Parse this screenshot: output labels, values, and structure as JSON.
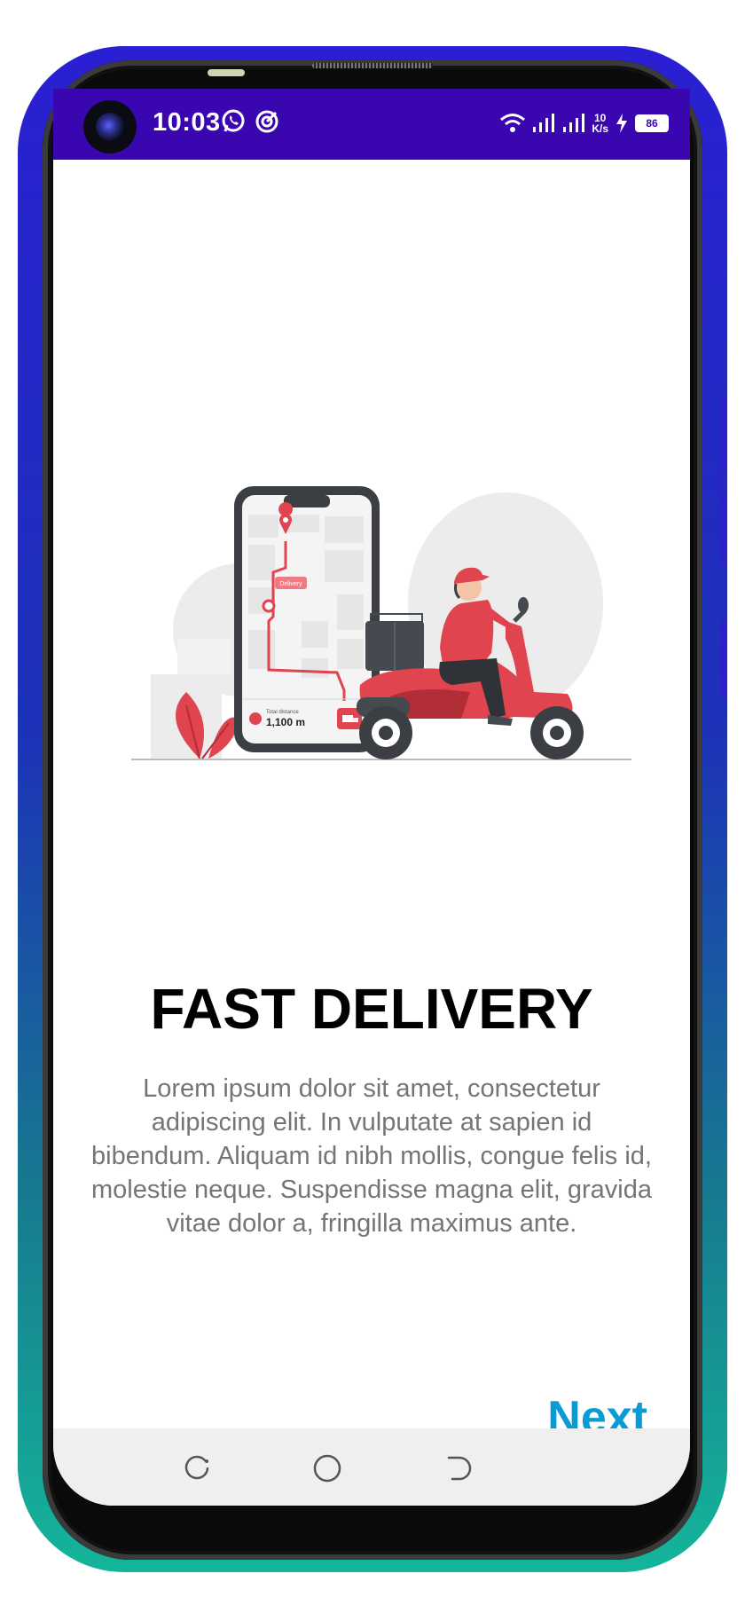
{
  "status_bar": {
    "time": "10:03",
    "network_speed_top": "10",
    "network_speed_unit": "K/s",
    "battery_level": "86",
    "icons": [
      "whatsapp-icon",
      "target-icon",
      "wifi-icon",
      "signal-icon",
      "signal-icon",
      "charging-icon",
      "battery-icon"
    ]
  },
  "onboarding": {
    "illustration_text": {
      "pin_label": "Delivery",
      "distance_label": "Total distance",
      "distance_value": "1,100 m"
    },
    "title": "FAST DELIVERY",
    "description": "Lorem ipsum dolor sit amet, consectetur adipiscing elit. In vulputate at sapien id bibendum. Aliquam id nibh mollis, congue felis id, molestie neque. Suspendisse magna elit, gravida vitae dolor a, fringilla maximus ante.",
    "next_label": "Next"
  },
  "navigation_bar": {
    "buttons": [
      "recents-icon",
      "home-icon",
      "back-icon"
    ]
  },
  "colors": {
    "status_bar": "#3a06b0",
    "accent": "#0a9bd6",
    "illustration_red": "#e0444e",
    "body_text": "#757575"
  }
}
